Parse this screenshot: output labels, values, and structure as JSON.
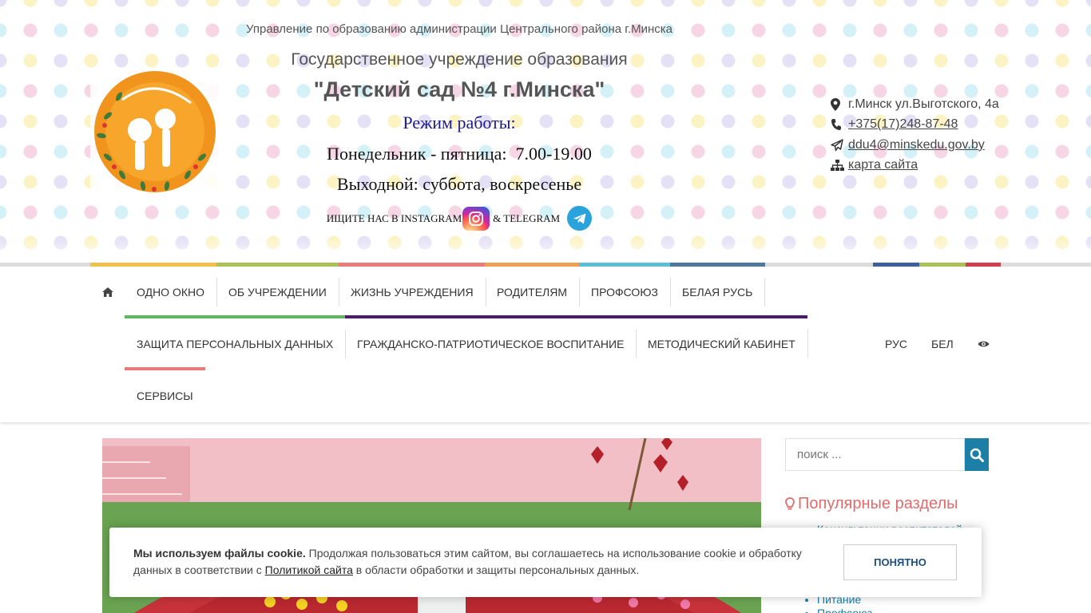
{
  "header": {
    "org_name": "Управление по образованию администрации Центрального района г.Минска",
    "inst_type": "Государственное учреждение образования",
    "inst_name": "\"Детский сад №4 г.Минска\"",
    "hours_title": "Режим работы:",
    "hours_week": "Понедельник - пятница:  7.00-19.00",
    "hours_off": "Выходной: суббота, воскресенье",
    "social_instagram": "ИЩИТЕ НАС В INSTAGRAM",
    "social_telegram": "& TELEGRAM",
    "logo_icon": "kindergarten-logo-icon"
  },
  "contacts": {
    "address": "г.Минск ул.Выготского, 4а",
    "phone": "+375(17)248-87-48",
    "email": "ddu4@minskedu.gov.by",
    "sitemap": "карта сайта"
  },
  "stripe_colors": [
    "#f0c24b",
    "#a8c256",
    "#ea7b7b",
    "#efa054",
    "#5ac0d8",
    "#4f78a0",
    "#dcdcdc",
    "#3e5f9c",
    "#a8c256",
    "#d43c4f"
  ],
  "nav": {
    "home_icon": "home-icon",
    "row1": [
      "ОДНО ОКНО",
      "ОБ УЧРЕЖДЕНИИ",
      "ЖИЗНЬ УЧРЕЖДЕНИЯ",
      "РОДИТЕЛЯМ",
      "ПРОФСОЮЗ",
      "БЕЛАЯ РУСЬ"
    ],
    "row2": [
      "ЗАЩИТА ПЕРСОНАЛЬНЫХ ДАННЫХ",
      "ГРАЖДАНСКО-ПАТРИОТИЧЕСКОЕ ВОСПИТАНИЕ",
      "МЕТОДИЧЕСКИЙ КАБИНЕТ"
    ],
    "row3": [
      "СЕРВИСЫ"
    ],
    "lang_ru": "РУС",
    "lang_be": "БЕЛ",
    "accessibility_icon": "eye-icon",
    "underline_colors": [
      "#5cb85c",
      "#4a1a6e",
      "#ea7b7b"
    ]
  },
  "sidebar": {
    "search_placeholder": "поиск ...",
    "popular_title": "Популярные разделы",
    "popular_items": [
      "Консультации воспитателей",
      "",
      "",
      "",
      "Питание",
      "Профсоюз"
    ]
  },
  "cookie": {
    "bold": "Мы используем файлы cookie.",
    "text1": " Продолжая пользоваться этим сайтом, вы соглашаетесь на использование cookie и обработку данных в соответствии с ",
    "link": "Политикой сайта",
    "text2": " в области обработки и защиты персональных данных.",
    "button": "ПОНЯТНО"
  }
}
